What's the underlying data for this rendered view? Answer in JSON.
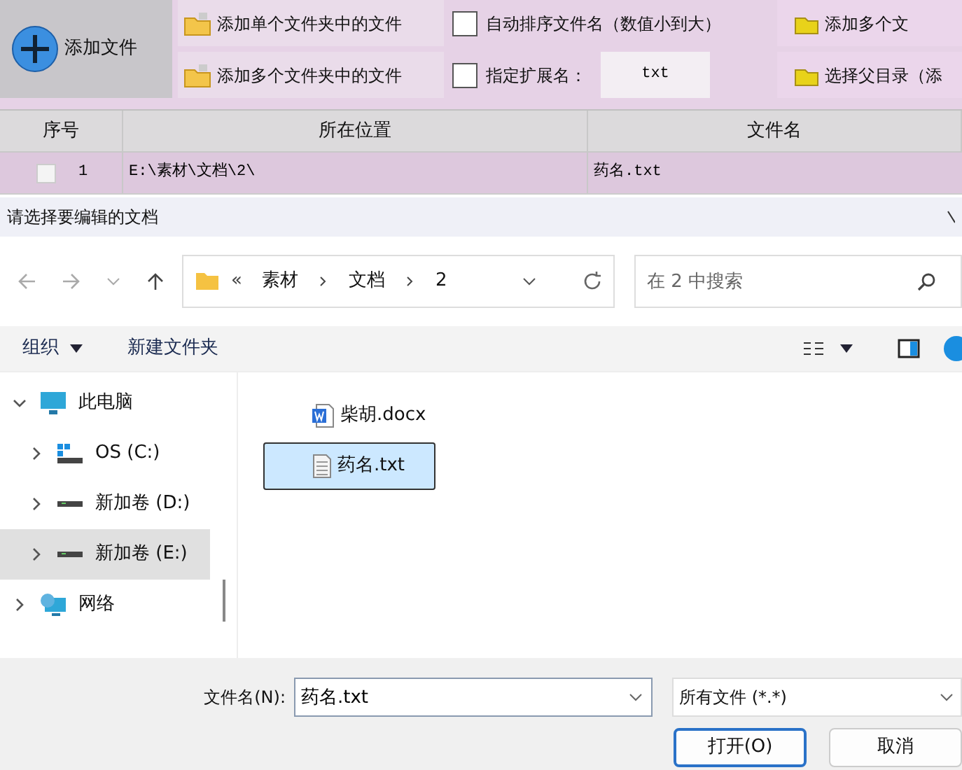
{
  "app": {
    "add_file_button": "添加文件",
    "toolbar_rows": [
      {
        "folder_button": "添加单个文件夹中的文件",
        "checkbox": {
          "label": "自动排序文件名（数值小到大）",
          "checked": false
        },
        "right_button": "添加多个文"
      },
      {
        "folder_button": "添加多个文件夹中的文件",
        "checkbox": {
          "label": "指定扩展名：",
          "checked": false
        },
        "extension_field": "txt",
        "right_button": "选择父目录（添"
      }
    ],
    "table": {
      "columns": [
        "序号",
        "所在位置",
        "文件名"
      ],
      "rows": [
        {
          "checked": false,
          "index": "1",
          "location": "E:\\素材\\文档\\2\\",
          "filename": "药名.txt"
        }
      ]
    }
  },
  "dialog": {
    "title": "请选择要编辑的文档",
    "breadcrumb_prefix": "«",
    "breadcrumb": [
      "素材",
      "文档",
      "2"
    ],
    "search": {
      "placeholder": "在 2 中搜索"
    },
    "commands": [
      {
        "label": "组织",
        "menu": true
      },
      {
        "label": "新建文件夹",
        "menu": false
      }
    ],
    "nav_tree": [
      {
        "label": "此电脑",
        "kind": "pc",
        "expanded": true,
        "selected": false,
        "children": [
          {
            "label": "OS (C:)",
            "kind": "osdrive",
            "expanded": false,
            "selected": false
          },
          {
            "label": "新加卷 (D:)",
            "kind": "drive",
            "expanded": false,
            "selected": false
          },
          {
            "label": "新加卷 (E:)",
            "kind": "drive",
            "expanded": false,
            "selected": true
          }
        ]
      },
      {
        "label": "网络",
        "kind": "network",
        "expanded": false,
        "selected": false
      }
    ],
    "files": [
      {
        "name": "柴胡.docx",
        "kind": "word",
        "selected": false
      },
      {
        "name": "药名.txt",
        "kind": "text",
        "selected": true
      }
    ],
    "filename_label": "文件名(N):",
    "filename_value": "药名.txt",
    "file_type": "所有文件 (*.*)",
    "buttons": [
      {
        "label": "打开(O)",
        "primary": true
      },
      {
        "label": "取消",
        "primary": false
      }
    ]
  }
}
